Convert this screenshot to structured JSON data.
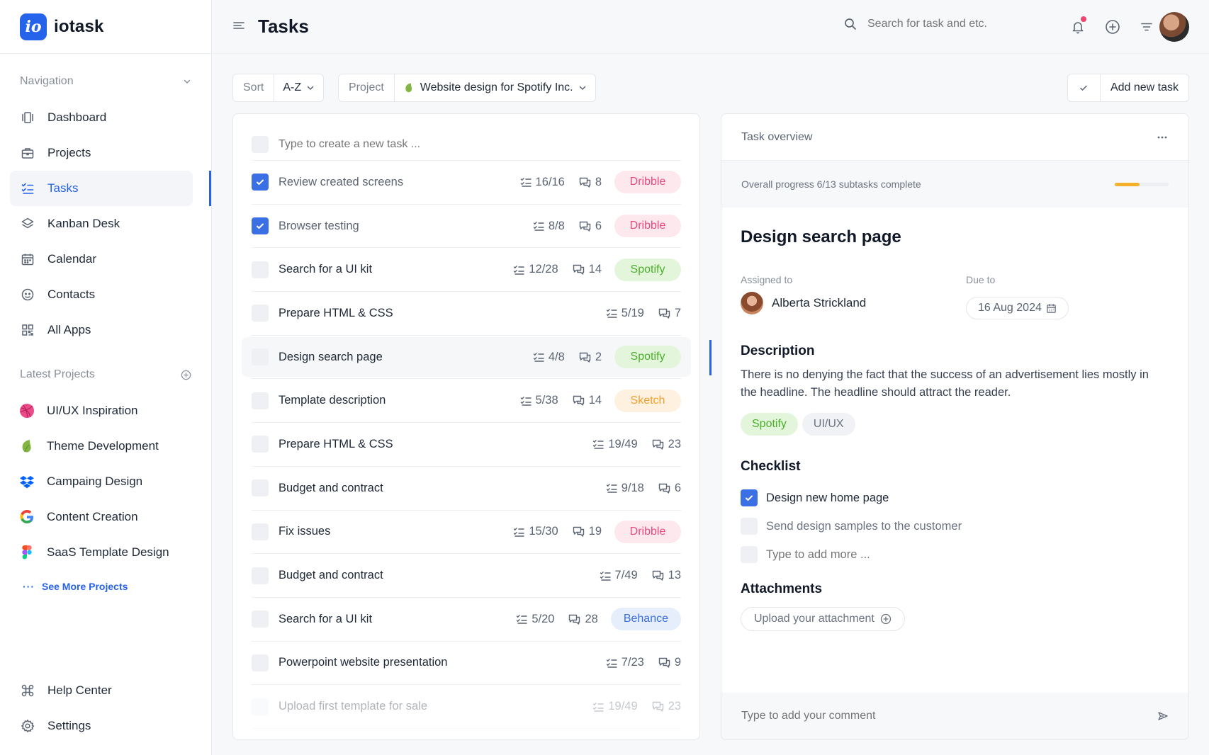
{
  "brand": {
    "logo_text": "io",
    "name": "iotask"
  },
  "nav": {
    "heading": "Navigation",
    "items": [
      {
        "label": "Dashboard",
        "icon": "dashboard-icon"
      },
      {
        "label": "Projects",
        "icon": "briefcase-icon"
      },
      {
        "label": "Tasks",
        "icon": "checklist-icon",
        "active": true
      },
      {
        "label": "Kanban Desk",
        "icon": "layers-icon"
      },
      {
        "label": "Calendar",
        "icon": "calendar-icon"
      },
      {
        "label": "Contacts",
        "icon": "contacts-icon"
      },
      {
        "label": "All Apps",
        "icon": "apps-grid-icon"
      }
    ]
  },
  "latest_projects": {
    "heading": "Latest Projects",
    "items": [
      {
        "label": "UI/UX Inspiration",
        "icon": "dribbble-icon"
      },
      {
        "label": "Theme Development",
        "icon": "envato-leaf-icon"
      },
      {
        "label": "Campaing Design",
        "icon": "dropbox-icon"
      },
      {
        "label": "Content Creation",
        "icon": "google-icon"
      },
      {
        "label": "SaaS Template Design",
        "icon": "figma-icon"
      }
    ],
    "see_more": "See More Projects"
  },
  "bottom_nav": [
    {
      "label": "Help Center",
      "icon": "command-icon"
    },
    {
      "label": "Settings",
      "icon": "gear-icon"
    }
  ],
  "header": {
    "title": "Tasks",
    "search_placeholder": "Search for task and etc."
  },
  "toolbar": {
    "sort_label": "Sort",
    "sort_value": "A-Z",
    "project_label": "Project",
    "project_value": "Website design for Spotify Inc.",
    "add_task": "Add new task"
  },
  "task_list": {
    "new_task_placeholder": "Type to create a new task ...",
    "tasks": [
      {
        "name": "Review created screens",
        "subtasks": "16/16",
        "comments": "8",
        "tag": "Dribble",
        "done": true
      },
      {
        "name": "Browser testing",
        "subtasks": "8/8",
        "comments": "6",
        "tag": "Dribble",
        "done": true
      },
      {
        "name": "Search for a UI kit",
        "subtasks": "12/28",
        "comments": "14",
        "tag": "Spotify"
      },
      {
        "name": "Prepare HTML & CSS",
        "subtasks": "5/19",
        "comments": "7",
        "tag": ""
      },
      {
        "name": "Design search page",
        "subtasks": "4/8",
        "comments": "2",
        "tag": "Spotify",
        "selected": true
      },
      {
        "name": "Template description",
        "subtasks": "5/38",
        "comments": "14",
        "tag": "Sketch"
      },
      {
        "name": "Prepare HTML & CSS",
        "subtasks": "19/49",
        "comments": "23",
        "tag": ""
      },
      {
        "name": "Budget and contract",
        "subtasks": "9/18",
        "comments": "6",
        "tag": ""
      },
      {
        "name": "Fix issues",
        "subtasks": "15/30",
        "comments": "19",
        "tag": "Dribble"
      },
      {
        "name": "Budget and contract",
        "subtasks": "7/49",
        "comments": "13",
        "tag": ""
      },
      {
        "name": "Search for a UI kit",
        "subtasks": "5/20",
        "comments": "28",
        "tag": "Behance"
      },
      {
        "name": "Powerpoint website presentation",
        "subtasks": "7/23",
        "comments": "9",
        "tag": ""
      },
      {
        "name": "Upload first template for sale",
        "subtasks": "19/49",
        "comments": "23",
        "tag": "",
        "faded": true
      }
    ]
  },
  "overview": {
    "heading": "Task overview",
    "progress_text": "Overall progress 6/13 subtasks complete",
    "progress_fraction": 0.46,
    "title": "Design search page",
    "assigned_label": "Assigned to",
    "assignee": "Alberta Strickland",
    "due_label": "Due to",
    "due_date": "16 Aug 2024",
    "description_heading": "Description",
    "description": "There is no denying the fact that the success of an advertisement lies mostly in the headline. The headline should attract the reader.",
    "tags": [
      "Spotify",
      "UI/UX"
    ],
    "checklist_heading": "Checklist",
    "checklist": [
      {
        "label": "Design new home page",
        "done": true
      },
      {
        "label": "Send design samples to the customer",
        "done": false
      }
    ],
    "checklist_add_placeholder": "Type to add more ...",
    "attachments_heading": "Attachments",
    "upload_label": "Upload your attachment",
    "comment_placeholder": "Type to add your comment"
  },
  "colors": {
    "accent": "#2563eb",
    "dribble": "#e84a7b",
    "spotify": "#4caf2a",
    "sketch": "#f0a030",
    "behance": "#3b6fe4",
    "progress": "#f5b12d"
  }
}
